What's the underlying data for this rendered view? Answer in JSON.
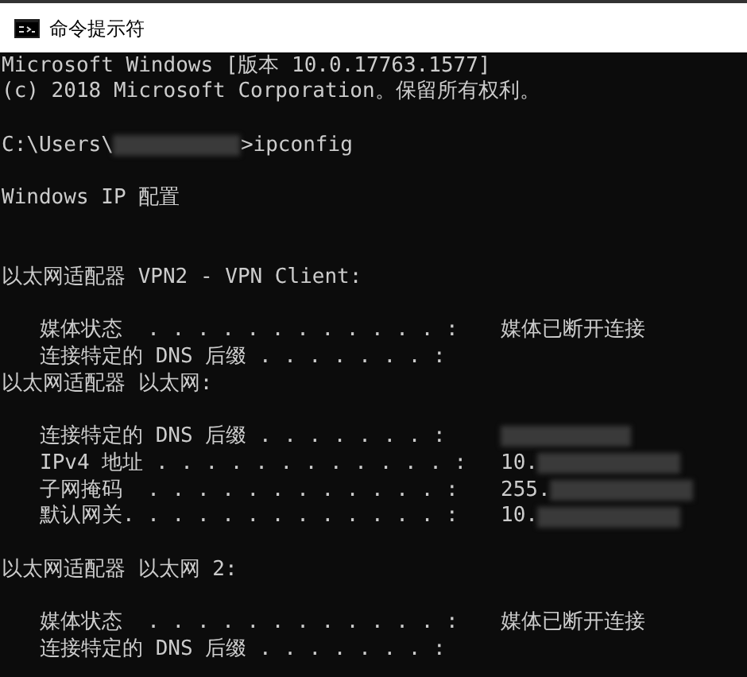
{
  "window": {
    "title": "命令提示符"
  },
  "console": {
    "lines": [
      {
        "kind": "text",
        "text": "Microsoft Windows [版本 10.0.17763.1577]"
      },
      {
        "kind": "text",
        "text": "(c) 2018 Microsoft Corporation。保留所有权利。"
      },
      {
        "kind": "blank"
      },
      {
        "kind": "prompt",
        "path": "C:\\Users\\",
        "command": ">ipconfig",
        "redacted": true
      },
      {
        "kind": "blank"
      },
      {
        "kind": "text",
        "text": "Windows IP 配置"
      },
      {
        "kind": "blank"
      },
      {
        "kind": "blank"
      },
      {
        "kind": "text",
        "text": "以太网适配器 VPN2 - VPN Client:"
      },
      {
        "kind": "blank"
      },
      {
        "kind": "entry",
        "label": "媒体状态  . . . . . . . . . . . . :",
        "value": "媒体已断开连接",
        "redacted": false
      },
      {
        "kind": "entry",
        "label": "连接特定的 DNS 后缀 . . . . . . . :",
        "redacted": false
      },
      {
        "kind": "text",
        "text": "以太网适配器 以太网:"
      },
      {
        "kind": "blank"
      },
      {
        "kind": "entry",
        "label": "连接特定的 DNS 后缀 . . . . . . . :",
        "redacted": true
      },
      {
        "kind": "entry",
        "label": "IPv4 地址 . . . . . . . . . . . . :",
        "value": "10.",
        "redacted": true
      },
      {
        "kind": "entry",
        "label": "子网掩码  . . . . . . . . . . . . :",
        "value": "255.",
        "redacted": true
      },
      {
        "kind": "entry",
        "label": "默认网关. . . . . . . . . . . . . :",
        "value": "10.",
        "redacted": true
      },
      {
        "kind": "blank"
      },
      {
        "kind": "text",
        "text": "以太网适配器 以太网 2:"
      },
      {
        "kind": "blank"
      },
      {
        "kind": "entry",
        "label": "媒体状态  . . . . . . . . . . . . :",
        "value": "媒体已断开连接",
        "redacted": false
      },
      {
        "kind": "entry",
        "label": "连接特定的 DNS 后缀 . . . . . . . :",
        "redacted": false
      }
    ]
  }
}
